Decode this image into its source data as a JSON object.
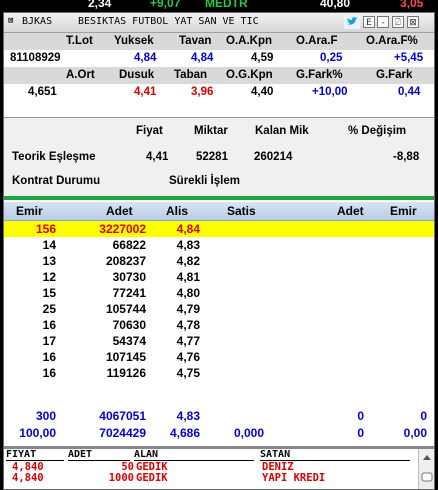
{
  "top_strip": {
    "items": [
      "2,34",
      "+9,07",
      "MEDTR",
      "40,80",
      "3,05"
    ]
  },
  "window": {
    "icon_label": "⊠",
    "code": "BJKAS",
    "name": "BESIKTAS FUTBOL YAT SAN VE TIC",
    "btn_e": "E",
    "btn_min": "-",
    "btn_max": "⍁",
    "btn_close": "⊠"
  },
  "summary": {
    "row1_headers": [
      "T.Lot",
      "Yuksek",
      "Tavan",
      "O.A.Kpn",
      "O.Ara.F",
      "O.Ara.F%"
    ],
    "row1_values": [
      "81108929",
      "4,84",
      "4,84",
      "4,59",
      "0,25",
      "+5,45"
    ],
    "row2_headers": [
      "A.Ort",
      "Dusuk",
      "Taban",
      "O.G.Kpn",
      "G.Fark%",
      "G.Fark"
    ],
    "row2_values": [
      "4,651",
      "4,41",
      "3,96",
      "4,40",
      "+10,00",
      "0,44"
    ]
  },
  "theoretical": {
    "headers": [
      "Fiyat",
      "Miktar",
      "Kalan Mik",
      "% Değişim"
    ],
    "label": "Teorik Eşleşme",
    "values": [
      "4,41",
      "52281",
      "260214",
      "-8,88"
    ],
    "contract_label": "Kontrat Durumu",
    "contract_value": "Sürekli İşlem"
  },
  "depth": {
    "headers": [
      "Emir",
      "Adet",
      "Alis",
      "Satis",
      "Adet",
      "Emir"
    ],
    "rows": [
      {
        "emir": "156",
        "adet": "3227002",
        "alis": "4,84"
      },
      {
        "emir": "14",
        "adet": "66822",
        "alis": "4,83"
      },
      {
        "emir": "13",
        "adet": "208237",
        "alis": "4,82"
      },
      {
        "emir": "12",
        "adet": "30730",
        "alis": "4,81"
      },
      {
        "emir": "15",
        "adet": "77241",
        "alis": "4,80"
      },
      {
        "emir": "25",
        "adet": "105744",
        "alis": "4,79"
      },
      {
        "emir": "16",
        "adet": "70630",
        "alis": "4,78"
      },
      {
        "emir": "17",
        "adet": "54374",
        "alis": "4,77"
      },
      {
        "emir": "16",
        "adet": "107145",
        "alis": "4,76"
      },
      {
        "emir": "16",
        "adet": "119126",
        "alis": "4,75"
      }
    ],
    "total1": {
      "emir": "300",
      "adet": "4067051",
      "alis": "4,83",
      "sadet": "0",
      "semir": "0"
    },
    "total2": {
      "emir": "100,00",
      "adet": "7024429",
      "alis": "4,686",
      "satis": "0,000",
      "sadet": "0",
      "semir": "0,00"
    }
  },
  "trades": {
    "headers": [
      "FIYAT",
      "ADET",
      "ALAN",
      "SATAN"
    ],
    "rows": [
      {
        "fiyat": "4,840",
        "adet": "50",
        "alan": "GEDIK",
        "satan": "DENIZ"
      },
      {
        "fiyat": "4,840",
        "adet": "1000",
        "alan": "GEDIK",
        "satan": "YAPI KREDI"
      }
    ]
  },
  "colors": {
    "highlight": "#ffff00",
    "red": "#dd0000",
    "blue": "#0000dd",
    "green_bar": "#1aa640"
  }
}
